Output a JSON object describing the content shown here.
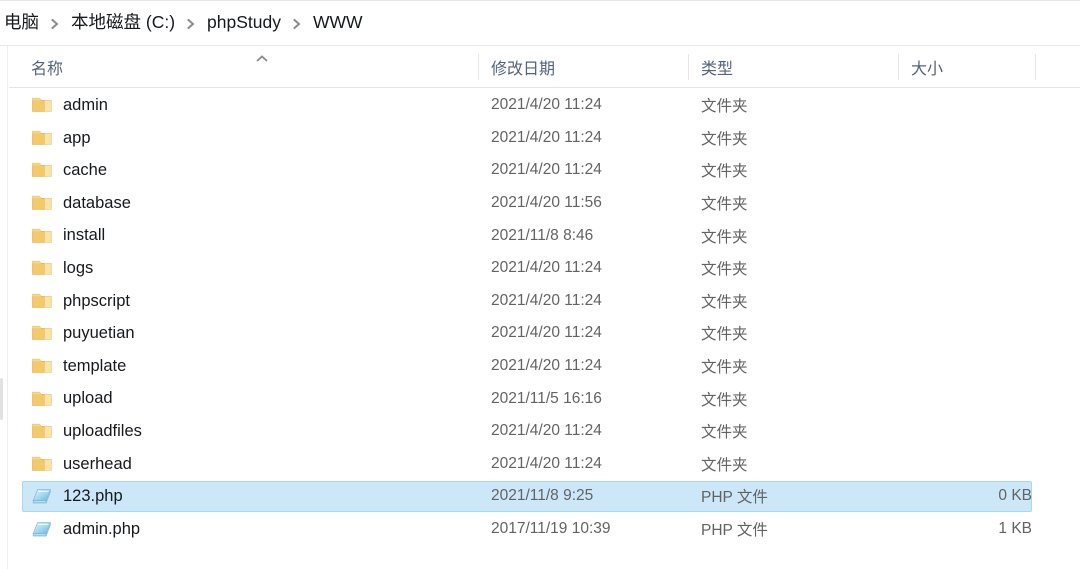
{
  "window": {
    "app": "Windows File Explorer"
  },
  "breadcrumb": {
    "separator_icon": "chevron-right-icon",
    "items": [
      {
        "label": "电脑"
      },
      {
        "label": "本地磁盘 (C:)"
      },
      {
        "label": "phpStudy"
      },
      {
        "label": "WWW"
      }
    ]
  },
  "columns": {
    "sort_icon": "chevron-up-icon",
    "sort_column": "名称",
    "sort_direction": "ascending",
    "headers": [
      {
        "key": "name",
        "label": "名称"
      },
      {
        "key": "date",
        "label": "修改日期"
      },
      {
        "key": "type",
        "label": "类型"
      },
      {
        "key": "size",
        "label": "大小"
      }
    ]
  },
  "colors": {
    "selection_fill": "#cce8f8",
    "selection_border": "#a8d8ef",
    "header_text": "#55637c",
    "row_text": "#16191d",
    "meta_text": "#636363",
    "folder_icon": "#f7d18b"
  },
  "files": {
    "rows": [
      {
        "icon": "folder-icon",
        "name": "admin",
        "date": "2021/4/20 11:24",
        "type": "文件夹",
        "size": "",
        "selected": false
      },
      {
        "icon": "folder-icon",
        "name": "app",
        "date": "2021/4/20 11:24",
        "type": "文件夹",
        "size": "",
        "selected": false
      },
      {
        "icon": "folder-icon",
        "name": "cache",
        "date": "2021/4/20 11:24",
        "type": "文件夹",
        "size": "",
        "selected": false
      },
      {
        "icon": "folder-icon",
        "name": "database",
        "date": "2021/4/20 11:56",
        "type": "文件夹",
        "size": "",
        "selected": false
      },
      {
        "icon": "folder-icon",
        "name": "install",
        "date": "2021/11/8 8:46",
        "type": "文件夹",
        "size": "",
        "selected": false
      },
      {
        "icon": "folder-icon",
        "name": "logs",
        "date": "2021/4/20 11:24",
        "type": "文件夹",
        "size": "",
        "selected": false
      },
      {
        "icon": "folder-icon",
        "name": "phpscript",
        "date": "2021/4/20 11:24",
        "type": "文件夹",
        "size": "",
        "selected": false
      },
      {
        "icon": "folder-icon",
        "name": "puyuetian",
        "date": "2021/4/20 11:24",
        "type": "文件夹",
        "size": "",
        "selected": false
      },
      {
        "icon": "folder-icon",
        "name": "template",
        "date": "2021/4/20 11:24",
        "type": "文件夹",
        "size": "",
        "selected": false
      },
      {
        "icon": "folder-icon",
        "name": "upload",
        "date": "2021/11/5 16:16",
        "type": "文件夹",
        "size": "",
        "selected": false
      },
      {
        "icon": "folder-icon",
        "name": "uploadfiles",
        "date": "2021/4/20 11:24",
        "type": "文件夹",
        "size": "",
        "selected": false
      },
      {
        "icon": "folder-icon",
        "name": "userhead",
        "date": "2021/4/20 11:24",
        "type": "文件夹",
        "size": "",
        "selected": false
      },
      {
        "icon": "php-file-icon",
        "name": "123.php",
        "date": "2021/11/8 9:25",
        "type": "PHP 文件",
        "size": "0 KB",
        "selected": true
      },
      {
        "icon": "php-file-icon",
        "name": "admin.php",
        "date": "2017/11/19 10:39",
        "type": "PHP 文件",
        "size": "1 KB",
        "selected": false
      }
    ]
  }
}
